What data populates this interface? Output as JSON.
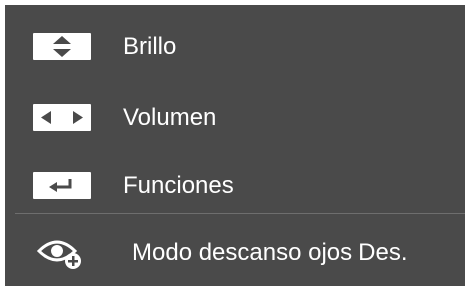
{
  "menu": {
    "items": [
      {
        "icon": "up-down-arrows-icon",
        "label": "Brillo"
      },
      {
        "icon": "left-right-arrows-icon",
        "label": "Volumen"
      },
      {
        "icon": "enter-return-icon",
        "label": "Funciones"
      }
    ],
    "eye_saver": {
      "icon": "eye-saver-icon",
      "label": "Modo descanso ojos",
      "value": "Des."
    }
  },
  "colors": {
    "background": "#4a4a4a",
    "text": "#ffffff",
    "icon_fill": "#ffffff",
    "divider": "#6e6e6e"
  }
}
